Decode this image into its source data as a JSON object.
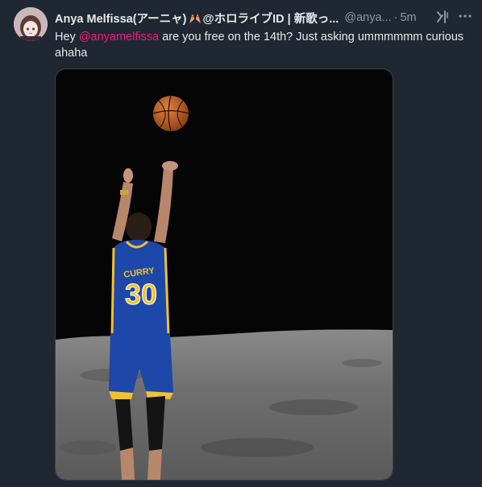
{
  "tweet": {
    "display_name_prefix": "Anya Melfissa(アーニャ)",
    "display_name_suffix": "@ホロライブID | 新歌っ...",
    "name_emoji": "hands-emoji",
    "handle": "@anya...",
    "separator": "·",
    "time": "5m",
    "text_before_mention": "Hey ",
    "mention": "@anyamelfissa",
    "text_after_mention": " are you free on the 14th? Just asking ummmmmm curious ahaha",
    "media_jersey_name": "CURRY",
    "media_jersey_number": "30"
  },
  "icons": {
    "grok": "grok-icon",
    "more": "more-icon"
  },
  "colors": {
    "background": "#1e2732",
    "text": "#e7e9ea",
    "secondary_text": "#8b98a5",
    "mention": "#f91880",
    "border": "#38444d"
  }
}
